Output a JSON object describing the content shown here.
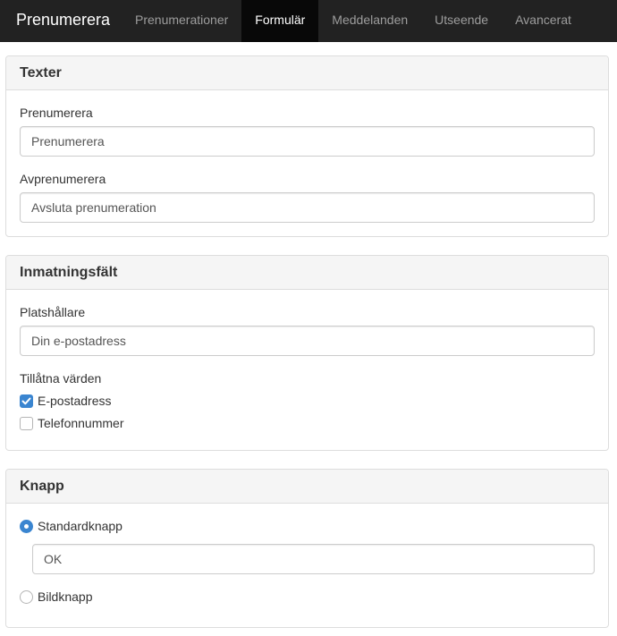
{
  "nav": {
    "brand": "Prenumerera",
    "items": [
      {
        "label": "Prenumerationer",
        "active": false
      },
      {
        "label": "Formulär",
        "active": true
      },
      {
        "label": "Meddelanden",
        "active": false
      },
      {
        "label": "Utseende",
        "active": false
      },
      {
        "label": "Avancerat",
        "active": false
      }
    ]
  },
  "texts_panel": {
    "heading": "Texter",
    "subscribe_label": "Prenumerera",
    "subscribe_value": "Prenumerera",
    "unsubscribe_label": "Avprenumerera",
    "unsubscribe_value": "Avsluta prenumeration"
  },
  "input_panel": {
    "heading": "Inmatningsfält",
    "placeholder_label": "Platshållare",
    "placeholder_value": "Din e-postadress",
    "allowed_label": "Tillåtna värden",
    "options": [
      {
        "label": "E-postadress",
        "checked": true
      },
      {
        "label": "Telefonnummer",
        "checked": false
      }
    ]
  },
  "button_panel": {
    "heading": "Knapp",
    "standard_label": "Standardknapp",
    "standard_selected": true,
    "standard_text_value": "OK",
    "image_label": "Bildknapp",
    "image_selected": false
  },
  "colors": {
    "navbar": "#222222",
    "nav_active": "#080808",
    "accent": "#3a85d0"
  }
}
